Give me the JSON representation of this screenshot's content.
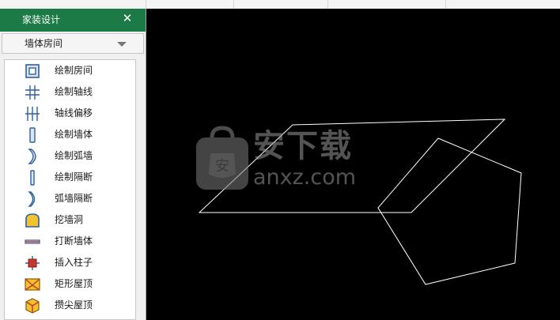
{
  "panel": {
    "title": "家装设计",
    "close_glyph": "✕",
    "category": "墙体房间",
    "items": [
      {
        "label": "绘制房间",
        "icon": "room-square-icon"
      },
      {
        "label": "绘制轴线",
        "icon": "axis-grid-icon"
      },
      {
        "label": "轴线偏移",
        "icon": "axis-offset-icon"
      },
      {
        "label": "绘制墙体",
        "icon": "wall-icon"
      },
      {
        "label": "绘制弧墙",
        "icon": "arc-wall-icon"
      },
      {
        "label": "绘制隔断",
        "icon": "partition-icon"
      },
      {
        "label": "弧墙隔断",
        "icon": "arc-partition-icon"
      },
      {
        "label": "挖墙洞",
        "icon": "wall-hole-icon"
      },
      {
        "label": "打断墙体",
        "icon": "break-wall-icon"
      },
      {
        "label": "插入柱子",
        "icon": "column-icon"
      },
      {
        "label": "矩形屋顶",
        "icon": "rect-roof-icon"
      },
      {
        "label": "攒尖屋顶",
        "icon": "pyramid-roof-icon"
      }
    ]
  },
  "watermark": {
    "text_cn": "安下载",
    "text_en": "anxz.com",
    "badge_char": "安"
  },
  "colors": {
    "titlebar": "#1b7a45",
    "canvas": "#000000",
    "icon_blue": "#2e5f9e",
    "icon_yellow": "#f2c230",
    "icon_red": "#c0392b"
  }
}
